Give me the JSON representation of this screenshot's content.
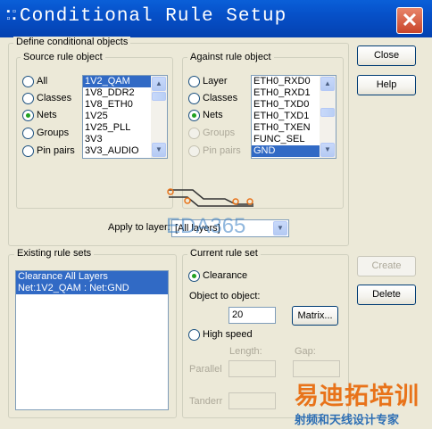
{
  "window": {
    "title": "Conditional Rule Setup"
  },
  "define_group": {
    "label": "Define conditional objects",
    "source": {
      "label": "Source rule object",
      "options": [
        {
          "label": "All",
          "checked": false,
          "enabled": true
        },
        {
          "label": "Classes",
          "checked": false,
          "enabled": true
        },
        {
          "label": "Nets",
          "checked": true,
          "enabled": true
        },
        {
          "label": "Groups",
          "checked": false,
          "enabled": true
        },
        {
          "label": "Pin pairs",
          "checked": false,
          "enabled": true
        }
      ],
      "list": [
        "1V2_QAM",
        "1V8_DDR2",
        "1V8_ETH0",
        "1V25",
        "1V25_PLL",
        "3V3",
        "3V3_AUDIO"
      ],
      "selected_index": 0
    },
    "against": {
      "label": "Against rule object",
      "options": [
        {
          "label": "Layer",
          "checked": false,
          "enabled": true
        },
        {
          "label": "Classes",
          "checked": false,
          "enabled": true
        },
        {
          "label": "Nets",
          "checked": true,
          "enabled": true
        },
        {
          "label": "Groups",
          "checked": false,
          "enabled": false
        },
        {
          "label": "Pin pairs",
          "checked": false,
          "enabled": false
        }
      ],
      "list": [
        "ETH0_RXD0",
        "ETH0_RXD1",
        "ETH0_TXD0",
        "ETH0_TXD1",
        "ETH0_TXEN",
        "FUNC_SEL",
        "GND"
      ],
      "selected_index": 6
    },
    "apply_to_layer": {
      "label": "Apply to layer:",
      "value": "[All layers]"
    }
  },
  "buttons": {
    "close": "Close",
    "help": "Help",
    "create": "Create",
    "delete": "Delete",
    "matrix": "Matrix..."
  },
  "existing_rule_sets": {
    "label": "Existing rule sets",
    "items": [
      "Clearance  All Layers",
      "Net:1V2_QAM : Net:GND"
    ]
  },
  "current_rule_set": {
    "label": "Current rule set",
    "clearance_label": "Clearance",
    "object_to_object_label": "Object to object:",
    "object_to_object_value": "20",
    "high_speed_label": "High speed",
    "length_label": "Length:",
    "gap_label": "Gap:",
    "parallel_label": "Parallel",
    "tandem_label": "Tanderr"
  },
  "watermarks": {
    "eda": "EDA365",
    "cn_title": "易迪拓培训",
    "cn_sub": "射频和天线设计专家"
  },
  "colors": {
    "title_bar": "#0650C8",
    "selection": "#316AC5",
    "dialog_bg": "#ECE9D8",
    "watermark_orange": "#E8731A",
    "watermark_blue": "#3A7FC4"
  }
}
